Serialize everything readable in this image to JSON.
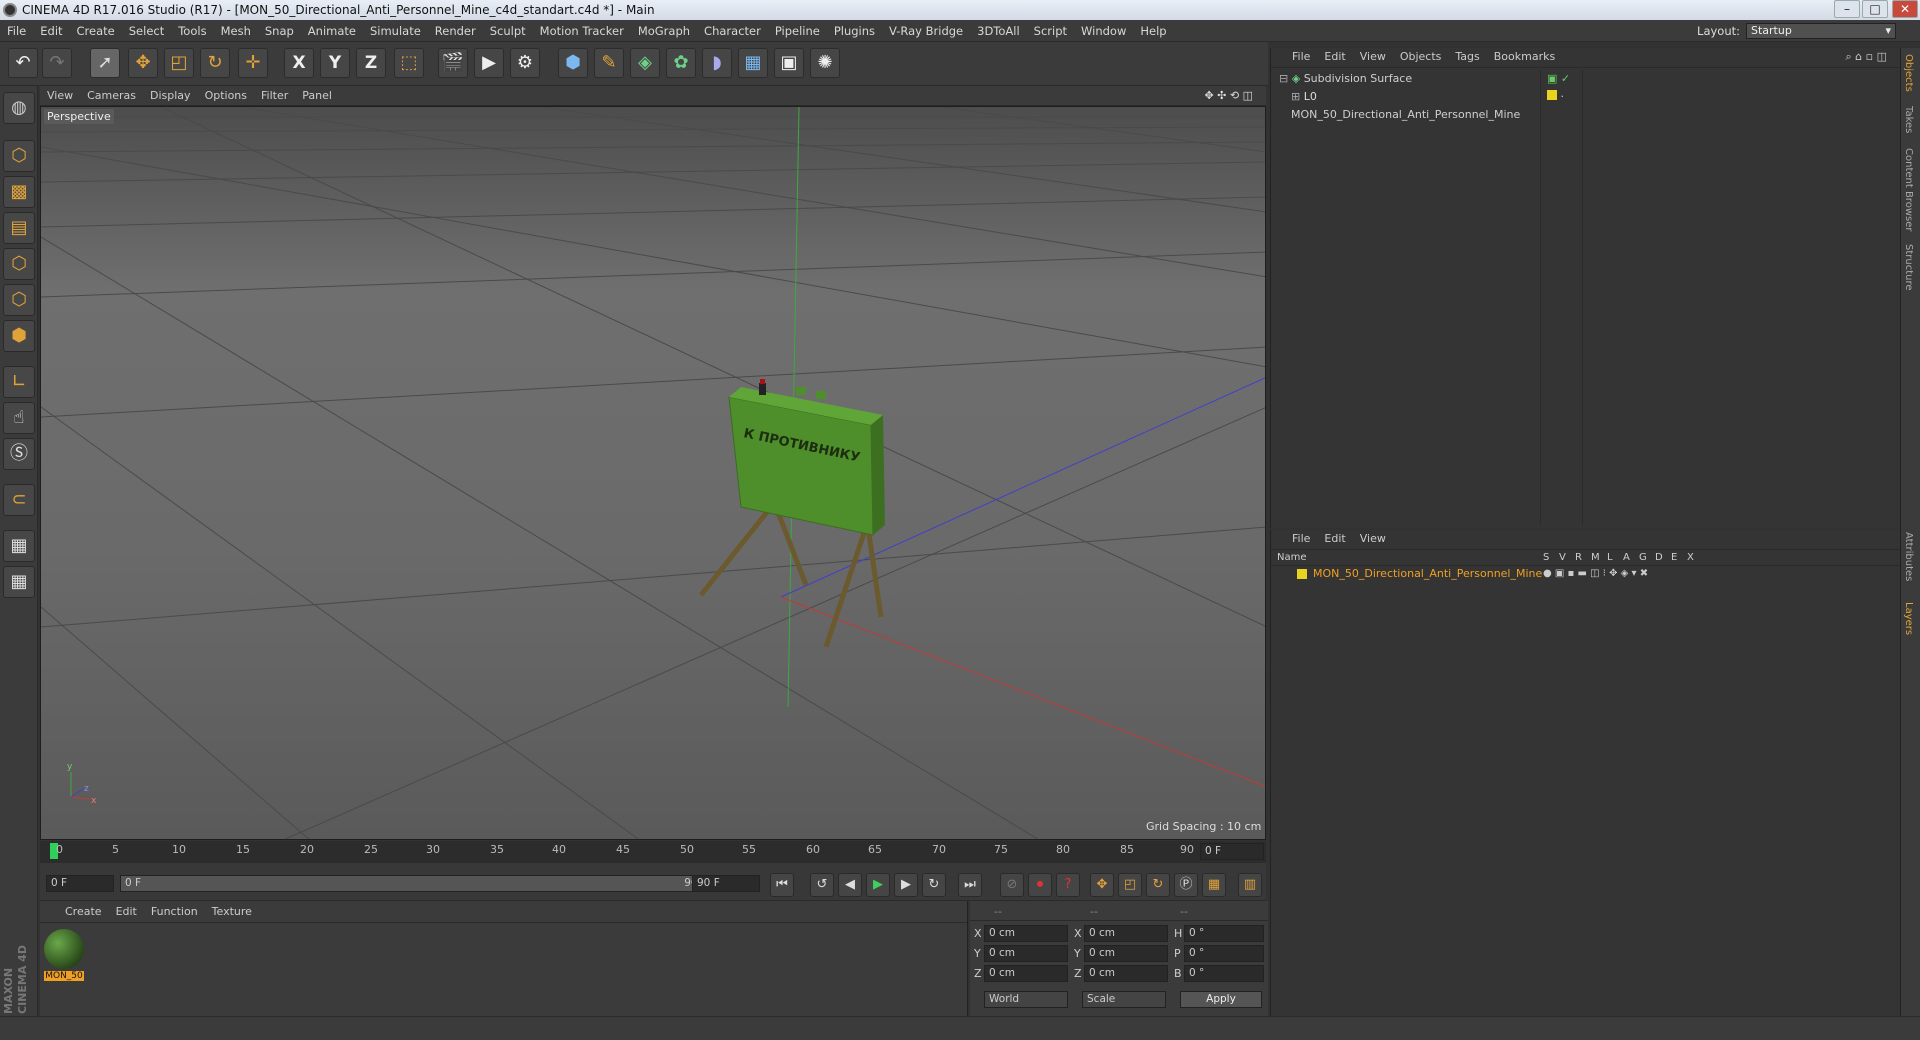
{
  "window": {
    "title": "CINEMA 4D R17.016 Studio (R17) - [MON_50_Directional_Anti_Personnel_Mine_c4d_standart.c4d *] - Main",
    "controls": [
      "–",
      "□",
      "✕"
    ]
  },
  "menubar": {
    "items": [
      "File",
      "Edit",
      "Create",
      "Select",
      "Tools",
      "Mesh",
      "Snap",
      "Animate",
      "Simulate",
      "Render",
      "Sculpt",
      "Motion Tracker",
      "MoGraph",
      "Character",
      "Pipeline",
      "Plugins",
      "V-Ray Bridge",
      "3DToAll",
      "Script",
      "Window",
      "Help"
    ],
    "layout_label": "Layout:",
    "layout_value": "Startup"
  },
  "toolbar": {
    "icons": [
      "undo-icon",
      "redo-icon",
      "select-icon",
      "move-icon",
      "scale-icon",
      "rotate-icon",
      "add-icon",
      "x-axis-icon",
      "y-axis-icon",
      "z-axis-icon",
      "coord-system-icon",
      "render-view-icon",
      "render-picture-viewer-icon",
      "render-settings-icon",
      "cube-icon",
      "pen-icon",
      "subdivision-icon",
      "cloner-icon",
      "deformer-icon",
      "floor-icon",
      "camera-icon",
      "light-icon"
    ],
    "axis_labels": [
      "X",
      "Y",
      "Z"
    ]
  },
  "viewport": {
    "menu": [
      "View",
      "Cameras",
      "Display",
      "Options",
      "Filter",
      "Panel"
    ],
    "camera_label": "Perspective",
    "grid_spacing": "Grid Spacing : 10 cm",
    "model_text": "К ПРОТИВНИКУ",
    "axis_labels": [
      "y",
      "z",
      "x"
    ]
  },
  "timeline": {
    "ticks": [
      "0",
      "5",
      "10",
      "15",
      "20",
      "25",
      "30",
      "35",
      "40",
      "45",
      "50",
      "55",
      "60",
      "65",
      "70",
      "75",
      "80",
      "85",
      "90"
    ],
    "current_frame": "0 F",
    "start_field": "0 F",
    "range_start": "0 F",
    "range_end": "90 F",
    "end_field": "90 F"
  },
  "material_manager": {
    "menu": [
      "Create",
      "Edit",
      "Function",
      "Texture"
    ],
    "material_name": "MON_50"
  },
  "coordinates": {
    "headers": [
      "--",
      "--",
      "--"
    ],
    "rows": [
      {
        "pos_label": "X",
        "pos": "0 cm",
        "size_label": "X",
        "size": "0 cm",
        "rot_label": "H",
        "rot": "0 °"
      },
      {
        "pos_label": "Y",
        "pos": "0 cm",
        "size_label": "Y",
        "size": "0 cm",
        "rot_label": "P",
        "rot": "0 °"
      },
      {
        "pos_label": "Z",
        "pos": "0 cm",
        "size_label": "Z",
        "size": "0 cm",
        "rot_label": "B",
        "rot": "0 °"
      }
    ],
    "mode": "World",
    "scale": "Scale",
    "apply": "Apply"
  },
  "object_manager": {
    "menu": [
      "File",
      "Edit",
      "View",
      "Objects",
      "Tags",
      "Bookmarks"
    ],
    "objects": [
      {
        "name": "Subdivision Surface"
      },
      {
        "name": "MON_50_Directional_Anti_Personnel_Mine"
      }
    ]
  },
  "layer_manager": {
    "menu": [
      "File",
      "Edit",
      "View"
    ],
    "columns": [
      "Name",
      "S",
      "V",
      "R",
      "M",
      "L",
      "A",
      "G",
      "D",
      "E",
      "X"
    ],
    "layer_name": "MON_50_Directional_Anti_Personnel_Mine"
  },
  "right_tabs": [
    "Objects",
    "Takes",
    "Content Browser",
    "Structure",
    "Attributes",
    "Layers"
  ],
  "branding": {
    "logo_text": "MAXON CINEMA 4D"
  },
  "colors": {
    "accent": "#e0a33a",
    "layer_yellow": "#e8d41e",
    "viewport_bg": "#616161"
  }
}
